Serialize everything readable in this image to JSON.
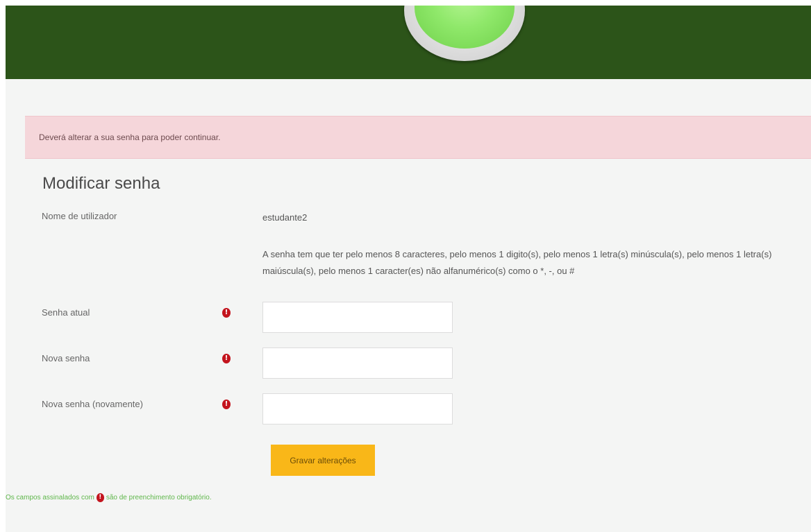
{
  "alert": {
    "message": "Deverá alterar a sua senha para poder continuar."
  },
  "form": {
    "title": "Modificar senha",
    "username_label": "Nome de utilizador",
    "username_value": "estudante2",
    "password_rules_line1": "A senha tem que ter pelo menos 8 caracteres, pelo menos 1 digito(s), pelo menos 1 letra(s) minúscula(s), pelo menos 1 letra(s)",
    "password_rules_line2": "maiúscula(s), pelo menos 1 caracter(es) não alfanumérico(s) como o *, -, ou #",
    "fields": [
      {
        "label": "Senha atual",
        "value": "",
        "required": true
      },
      {
        "label": "Nova senha",
        "value": "",
        "required": true
      },
      {
        "label": "Nova senha (novamente)",
        "value": "",
        "required": true
      }
    ],
    "required_icon": "exclamation-circle-icon",
    "save_label": "Gravar alterações"
  },
  "footer": {
    "note_before": "Os campos assinalados com",
    "note_after": "são de preenchimento obrigatório."
  },
  "colors": {
    "header": "#2c5419",
    "alert_bg": "#f5d6da",
    "required": "#c3141d",
    "button": "#f9b718",
    "footnote": "#5fb74b"
  }
}
